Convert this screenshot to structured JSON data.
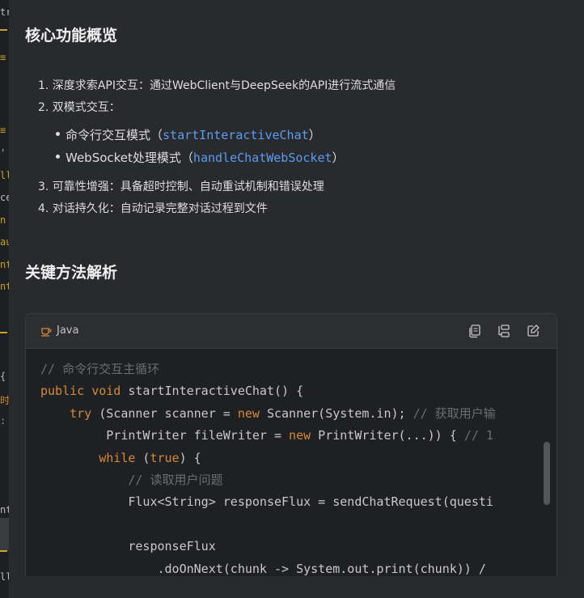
{
  "left_strip": {
    "fragments": [
      "tr",
      "≡",
      "≡",
      "'",
      "ll",
      "ce",
      "n",
      "au",
      "nt",
      "nt",
      "{",
      "时",
      ":",
      "nt",
      "ll"
    ]
  },
  "sections": {
    "overview_title": "核心功能概览",
    "overview_items": [
      "1. 深度求索API交互：通过WebClient与DeepSeek的API进行流式通信",
      "2. 双模式交互："
    ],
    "sub_items": [
      {
        "prefix": "命令行交互模式（",
        "code": "startInteractiveChat",
        "suffix": "）"
      },
      {
        "prefix": "WebSocket处理模式（",
        "code": "handleChatWebSocket",
        "suffix": "）"
      }
    ],
    "overview_items_more": [
      "3. 可靠性增强：具备超时控制、自动重试机制和错误处理",
      "4. 对话持久化：自动记录完整对话过程到文件"
    ],
    "methods_title": "关键方法解析"
  },
  "code_block": {
    "language": "Java",
    "lines": [
      [
        {
          "t": "// 命令行交互主循环",
          "c": "cmt"
        }
      ],
      [
        {
          "t": "public",
          "c": "kw"
        },
        {
          "t": " "
        },
        {
          "t": "void",
          "c": "kw"
        },
        {
          "t": " startInteractiveChat() {"
        }
      ],
      [
        {
          "t": "    "
        },
        {
          "t": "try",
          "c": "kw"
        },
        {
          "t": " (Scanner scanner = "
        },
        {
          "t": "new",
          "c": "kw"
        },
        {
          "t": " Scanner(System.in); "
        },
        {
          "t": "// 获取用户输",
          "c": "cmt"
        }
      ],
      [
        {
          "t": "         PrintWriter fileWriter = "
        },
        {
          "t": "new",
          "c": "kw"
        },
        {
          "t": " PrintWriter(...)) { "
        },
        {
          "t": "// 1",
          "c": "cmt"
        }
      ],
      [
        {
          "t": "        "
        },
        {
          "t": "while",
          "c": "kw"
        },
        {
          "t": " ("
        },
        {
          "t": "true",
          "c": "kw"
        },
        {
          "t": ") {"
        }
      ],
      [
        {
          "t": "            "
        },
        {
          "t": "// 读取用户问题",
          "c": "cmt"
        }
      ],
      [
        {
          "t": "            Flux<String> responseFlux = sendChatRequest(questi"
        }
      ],
      [
        {
          "t": ""
        }
      ],
      [
        {
          "t": "            responseFlux"
        }
      ],
      [
        {
          "t": "                .doOnNext(chunk -> System.out.print(chunk)) /"
        }
      ]
    ]
  },
  "icons": {
    "lang_icon": "coffee-cup-icon",
    "copy": "copy-icon",
    "wrap": "wrap-icon",
    "edit": "edit-icon"
  },
  "colors": {
    "background": "#292a2d",
    "code_bg": "#1f2023",
    "keyword": "#d38a3a",
    "comment": "#6a6d72",
    "inline_code": "#5b9cf0",
    "strip_accent": "#c9a227"
  }
}
